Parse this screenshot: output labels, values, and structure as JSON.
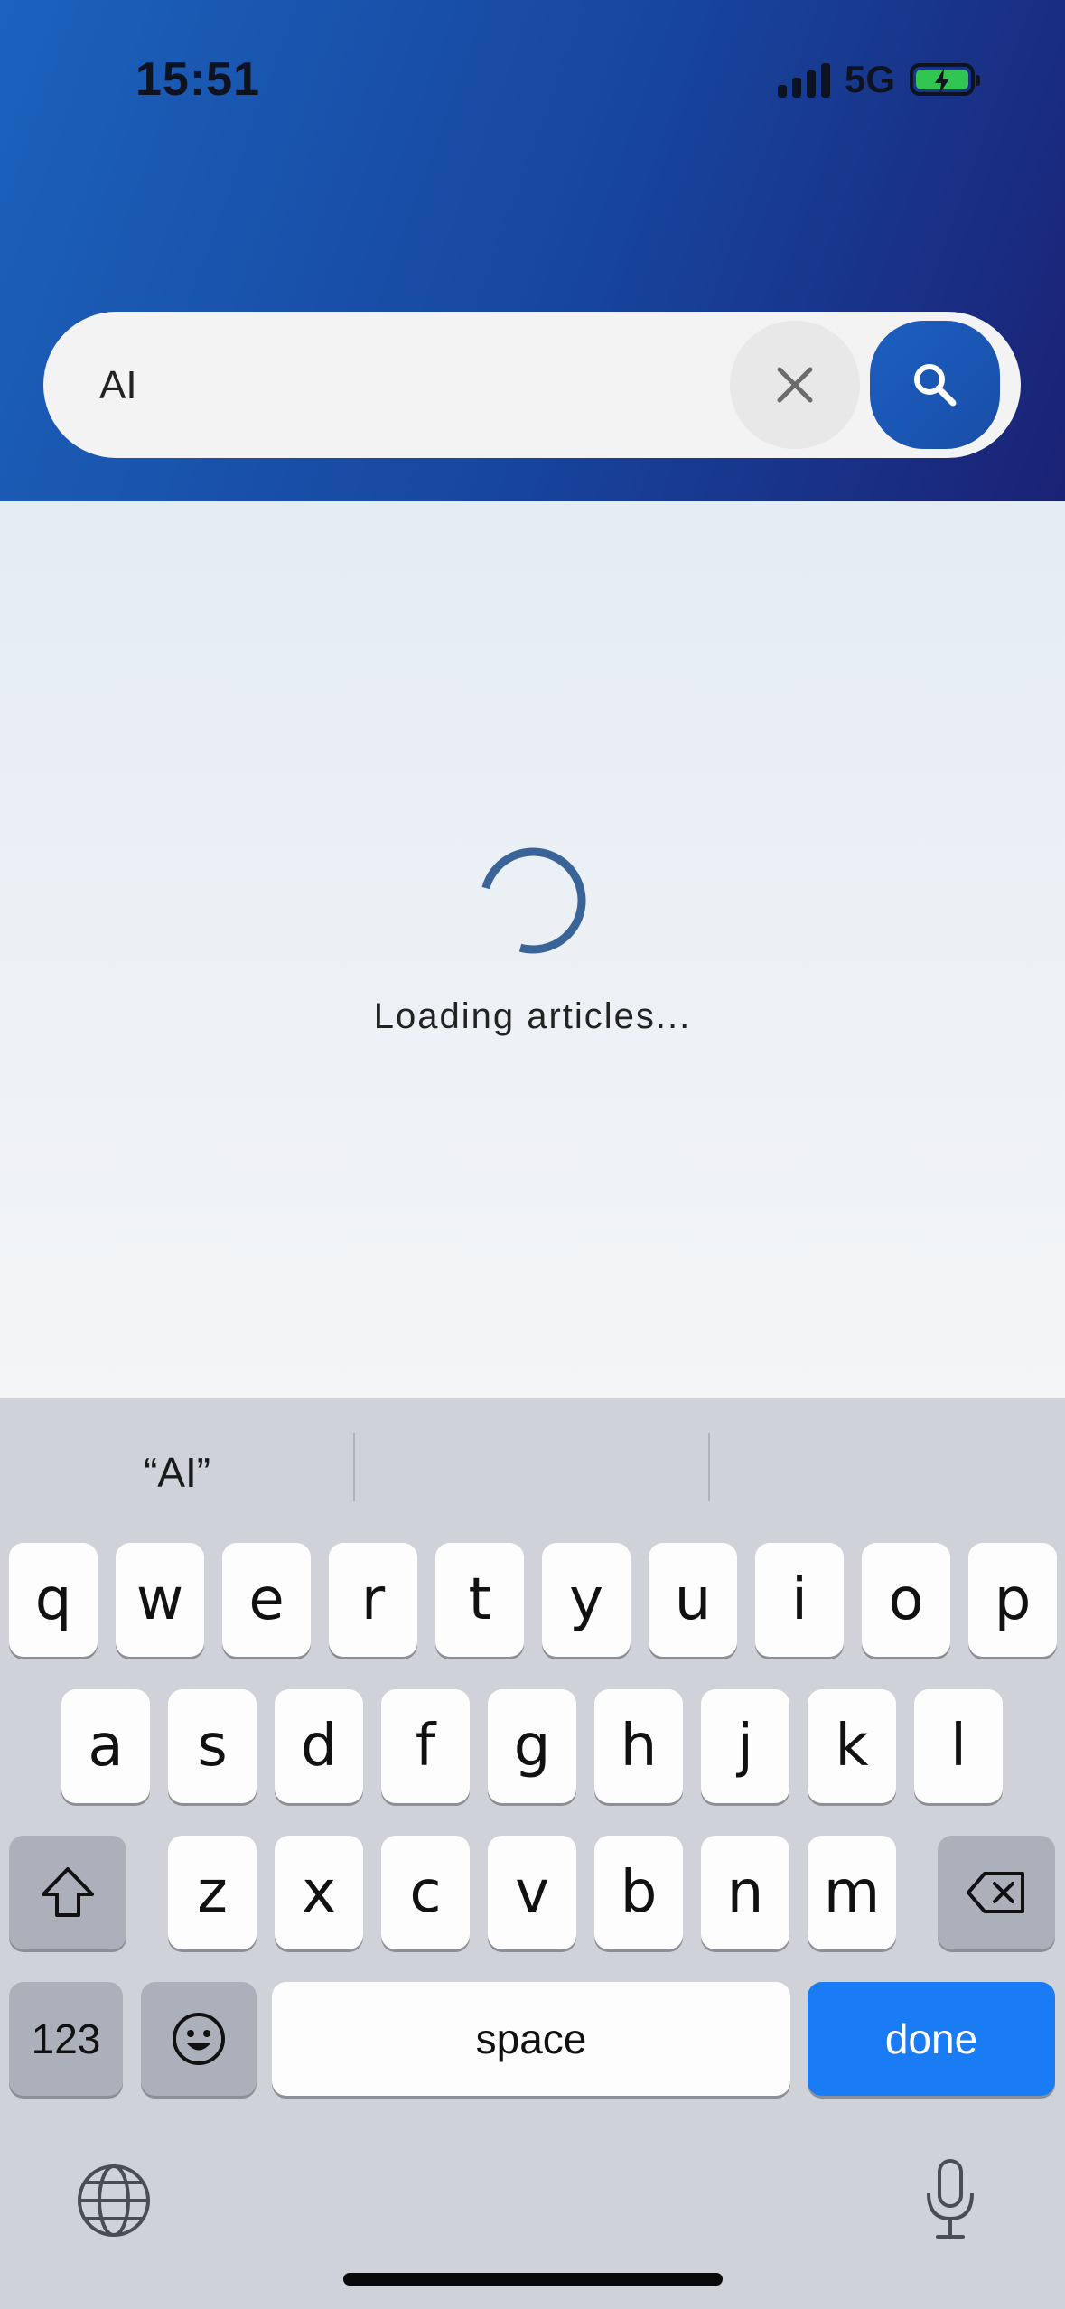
{
  "status_bar": {
    "time": "15:51",
    "network": "5G",
    "icons": [
      "signal-icon",
      "battery-charging-icon"
    ]
  },
  "search": {
    "value": "AI",
    "clear_icon": "close-icon",
    "search_icon": "search-icon"
  },
  "loading": {
    "text": "Loading articles...",
    "spinner_icon": "spinner-icon"
  },
  "keyboard": {
    "suggestions": [
      "“AI”",
      "",
      ""
    ],
    "row1": [
      "q",
      "w",
      "e",
      "r",
      "t",
      "y",
      "u",
      "i",
      "o",
      "p"
    ],
    "row2": [
      "a",
      "s",
      "d",
      "f",
      "g",
      "h",
      "j",
      "k",
      "l"
    ],
    "row3": [
      "z",
      "x",
      "c",
      "v",
      "b",
      "n",
      "m"
    ],
    "numbers_label": "123",
    "space_label": "space",
    "done_label": "done",
    "icons": [
      "shift-icon",
      "delete-icon",
      "emoji-icon",
      "globe-icon",
      "microphone-icon"
    ]
  },
  "colors": {
    "header_start": "#1b62bc",
    "header_end": "#1a2275",
    "accent": "#1a7cf5",
    "spinner": "#3a6497"
  }
}
